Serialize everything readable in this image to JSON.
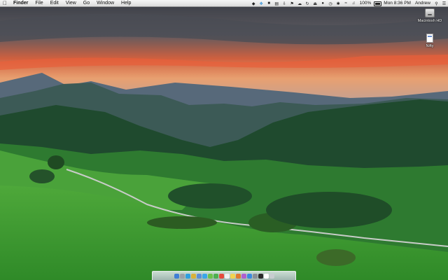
{
  "menubar": {
    "apple_icon": "apple-icon",
    "app_name": "Finder",
    "menus": [
      "File",
      "Edit",
      "View",
      "Go",
      "Window",
      "Help"
    ],
    "clock": "Mon 8:36 PM",
    "user": "Andrew",
    "battery": "100%",
    "status_icons": [
      "dropbox-icon",
      "twitter-icon",
      "evernote-icon",
      "dropbox-alt-icon",
      "download-icon",
      "flag-icon",
      "cloud-icon",
      "sync-icon",
      "eject-icon",
      "record-icon",
      "timemachine-icon",
      "bluetooth-icon",
      "wifi-icon",
      "volume-icon",
      "battery-icon",
      "spotlight-icon",
      "notification-icon"
    ]
  },
  "desktop": {
    "icons": [
      {
        "label": "Macintosh HD",
        "icon": "hard-drive-icon"
      },
      {
        "label": "Nifty",
        "icon": "document-icon"
      }
    ]
  },
  "dock": {
    "apps": [
      {
        "name": "finder",
        "color": "#3f7fd6"
      },
      {
        "name": "launchpad",
        "color": "#9aa0a8"
      },
      {
        "name": "safari",
        "color": "#2f9fe0"
      },
      {
        "name": "chrome",
        "color": "#d8b23a"
      },
      {
        "name": "mail",
        "color": "#5b8fd8"
      },
      {
        "name": "twitter",
        "color": "#3aa7e8"
      },
      {
        "name": "messages",
        "color": "#6cc24a"
      },
      {
        "name": "facetime",
        "color": "#4caf50"
      },
      {
        "name": "calendar",
        "color": "#e64a3b"
      },
      {
        "name": "reminders",
        "color": "#f0f0f0"
      },
      {
        "name": "notes",
        "color": "#f2d34f"
      },
      {
        "name": "photos",
        "color": "#e07a30"
      },
      {
        "name": "itunes",
        "color": "#b05fd0"
      },
      {
        "name": "appstore",
        "color": "#3b8ae0"
      },
      {
        "name": "preferences",
        "color": "#8a8f96"
      },
      {
        "name": "terminal",
        "color": "#2b2b2b"
      },
      {
        "name": "textedit",
        "color": "#ffffff"
      },
      {
        "name": "trash",
        "color": "#c8ccd0"
      }
    ]
  }
}
